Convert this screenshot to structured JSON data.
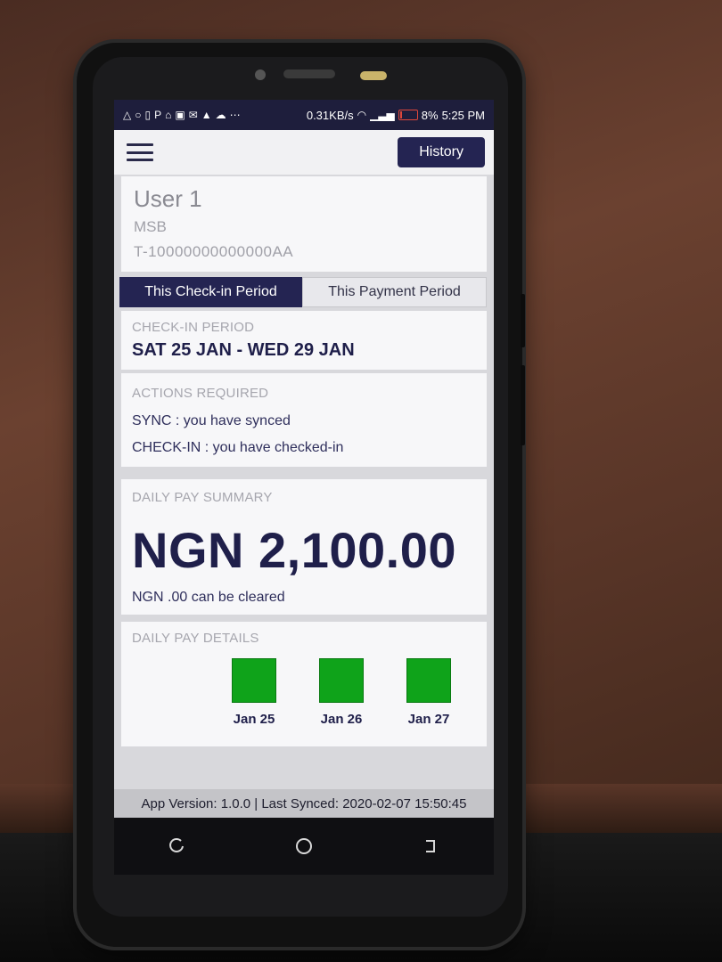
{
  "statusbar": {
    "network_speed": "0.31KB/s",
    "battery": "8%",
    "time": "5:25 PM"
  },
  "header": {
    "history_label": "History"
  },
  "user": {
    "name": "User 1",
    "org": "MSB",
    "id": "T-10000000000000AA"
  },
  "tabs": [
    {
      "label": "This Check-in Period",
      "active": true
    },
    {
      "label": "This Payment Period",
      "active": false
    }
  ],
  "checkin": {
    "label": "CHECK-IN PERIOD",
    "value": "SAT 25 JAN - WED 29 JAN"
  },
  "actions": {
    "label": "ACTIONS REQUIRED",
    "items": [
      "SYNC : you have synced",
      "CHECK-IN : you have checked-in"
    ]
  },
  "summary": {
    "label": "DAILY PAY SUMMARY",
    "amount": "NGN 2,100.00",
    "cleared": "NGN .00 can be cleared"
  },
  "details": {
    "label": "DAILY PAY DETAILS",
    "days": [
      {
        "label": "Jan 25",
        "color": "#0fa31a"
      },
      {
        "label": "Jan 26",
        "color": "#0fa31a"
      },
      {
        "label": "Jan 27",
        "color": "#0fa31a"
      }
    ]
  },
  "footer": {
    "text": "App Version: 1.0.0 | Last Synced: 2020-02-07 15:50:45"
  },
  "colors": {
    "primary": "#242452",
    "success": "#0fa31a"
  }
}
